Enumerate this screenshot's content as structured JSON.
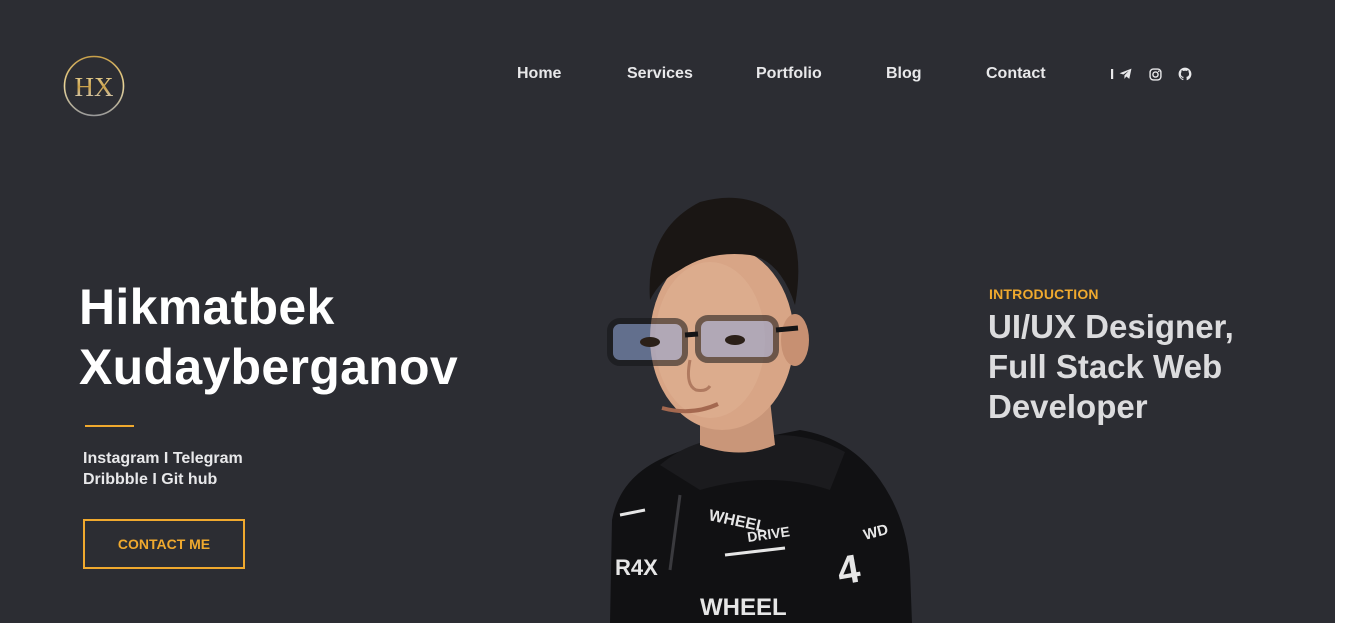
{
  "brand": {
    "logo_text": "HX",
    "colors": {
      "background": "#2c2d33",
      "accent": "#f0a92e",
      "text": "#e8e8ea"
    }
  },
  "nav": {
    "items": [
      {
        "label": "Home"
      },
      {
        "label": "Services"
      },
      {
        "label": "Portfolio"
      },
      {
        "label": "Blog"
      },
      {
        "label": "Contact"
      }
    ],
    "separator": "I",
    "social_icons": [
      "telegram-icon",
      "instagram-icon",
      "github-icon"
    ]
  },
  "hero": {
    "first_name": "Hikmatbek",
    "last_name": "Xudayberganov",
    "links_line1": {
      "a": "Instagram",
      "sep": "I",
      "b": "Telegram"
    },
    "links_line2": {
      "a": "Dribbble",
      "sep": "I",
      "b": "Git hub"
    },
    "cta_label": "CONTACT ME"
  },
  "intro": {
    "label": "INTRODUCTION",
    "role_lines": [
      "UI/UX Designer,",
      "Full Stack Web",
      "Developer"
    ]
  }
}
